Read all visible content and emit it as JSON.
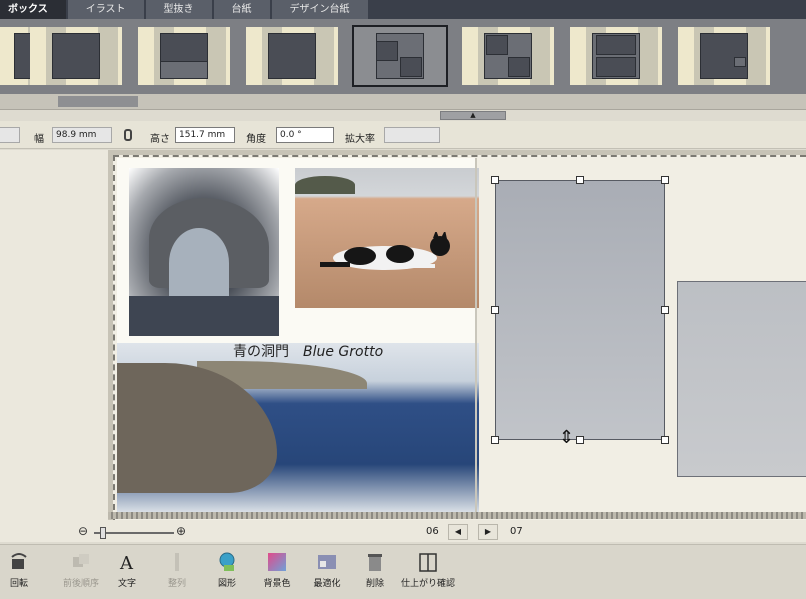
{
  "tabs": [
    {
      "label": "ボックス",
      "active": true
    },
    {
      "label": "イラスト",
      "active": false
    },
    {
      "label": "型抜き",
      "active": false
    },
    {
      "label": "台紙",
      "active": false
    },
    {
      "label": "デザイン台紙",
      "active": false
    }
  ],
  "properties": {
    "width_label": "幅",
    "width_value": "98.9 mm",
    "height_label": "高さ",
    "height_value": "151.7 mm",
    "angle_label": "角度",
    "angle_value": "0.0 °",
    "scale_label": "拡大率",
    "scale_value": ""
  },
  "caption": {
    "japanese": "青の洞門",
    "english": "Blue Grotto"
  },
  "pagination": {
    "left_page": "06",
    "right_page": "07",
    "prev_symbol": "◀",
    "next_symbol": "▶"
  },
  "toolbar": {
    "rotate": "回転",
    "flip": "前後順序",
    "text": "文字",
    "align": "整列",
    "shape": "図形",
    "background": "背景色",
    "optimize": "最適化",
    "delete": "削除",
    "preview": "仕上がり確認"
  },
  "zoom": {
    "level": 0.1
  }
}
